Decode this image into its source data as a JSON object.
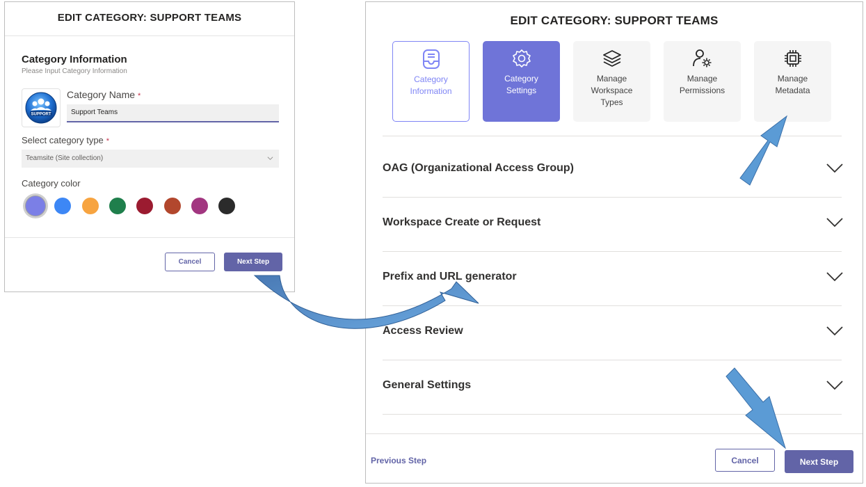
{
  "left": {
    "title": "EDIT CATEGORY: SUPPORT TEAMS",
    "section_title": "Category Information",
    "section_subtitle": "Please Input Category Information",
    "logo_text": "SUPPORT",
    "name_label": "Category Name",
    "required_mark": "*",
    "name_value": "Support Teams",
    "type_label": "Select category type",
    "type_value": "Teamsite (Site collection)",
    "color_label": "Category color",
    "colors": [
      "#7b7fe6",
      "#3d87f5",
      "#f7a440",
      "#1f7f4c",
      "#9b1b30",
      "#b2472d",
      "#a23680",
      "#2b2b2b"
    ],
    "selected_color_index": 0,
    "cancel_label": "Cancel",
    "next_label": "Next Step"
  },
  "right": {
    "title": "EDIT CATEGORY: SUPPORT TEAMS",
    "steps": [
      {
        "label": "Category\nInformation",
        "icon": "inbox-icon"
      },
      {
        "label": "Category\nSettings",
        "icon": "settings-icon"
      },
      {
        "label": "Manage\nWorkspace\nTypes",
        "icon": "layers-icon"
      },
      {
        "label": "Manage\nPermissions",
        "icon": "person-gear-icon"
      },
      {
        "label": "Manage\nMetadata",
        "icon": "chip-icon"
      }
    ],
    "accordion": [
      "OAG (Organizational Access Group)",
      "Workspace Create or Request",
      "Prefix and URL generator",
      "Access Review",
      "General Settings"
    ],
    "previous_label": "Previous Step",
    "cancel_label": "Cancel",
    "next_label": "Next Step"
  },
  "colors": {
    "accent": "#6264a7",
    "active_step": "#6f74d8",
    "arrow": "#5b9bd5"
  }
}
